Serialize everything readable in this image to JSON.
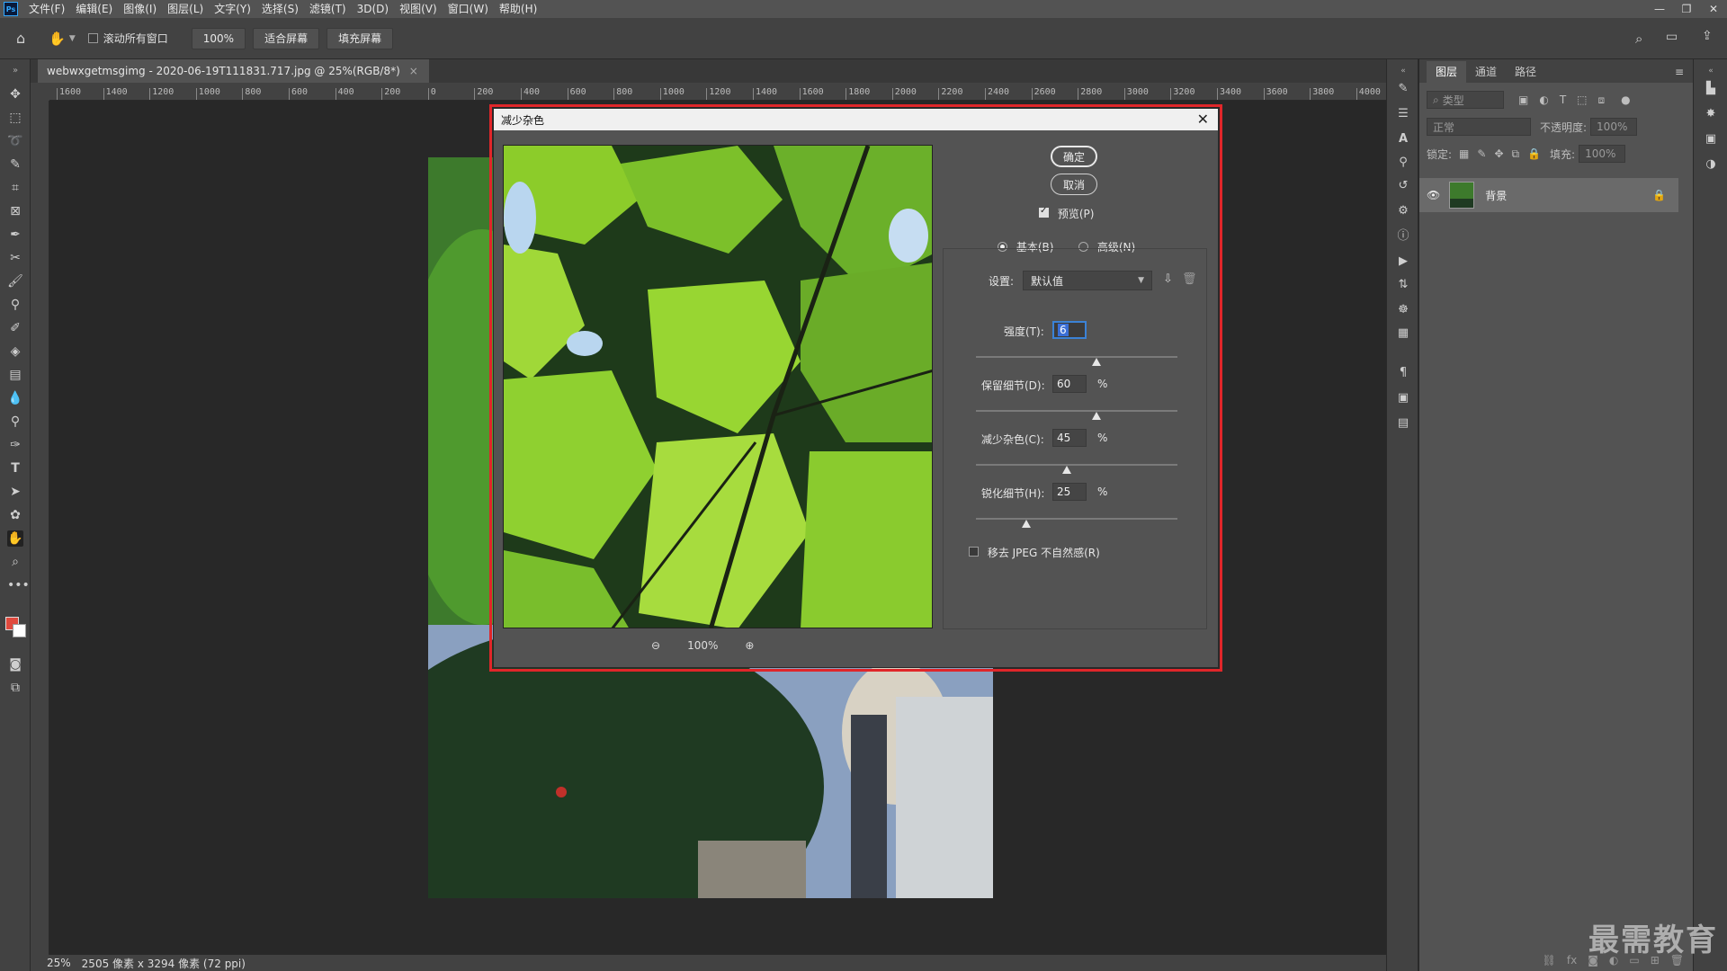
{
  "menu": {
    "logo": "Ps",
    "items": [
      "文件(F)",
      "编辑(E)",
      "图像(I)",
      "图层(L)",
      "文字(Y)",
      "选择(S)",
      "滤镜(T)",
      "3D(D)",
      "视图(V)",
      "窗口(W)",
      "帮助(H)"
    ]
  },
  "options": {
    "scroll_all_label": "滚动所有窗口",
    "zoom_value": "100%",
    "fit_screen": "适合屏幕",
    "fill_screen": "填充屏幕"
  },
  "document": {
    "tab_title": "webwxgetmsgimg - 2020-06-19T111831.717.jpg @ 25%(RGB/8*)",
    "tab_close": "×",
    "ruler_ticks": [
      "1600",
      "1400",
      "1200",
      "1000",
      "800",
      "600",
      "400",
      "200",
      "0",
      "200",
      "400",
      "600",
      "800",
      "1000",
      "1200",
      "1400",
      "1600",
      "1800",
      "2000",
      "2200",
      "2400",
      "2600",
      "2800",
      "3000",
      "3200",
      "3400",
      "3600",
      "3800",
      "4000"
    ]
  },
  "status": {
    "zoom": "25%",
    "info": "2505 像素 x 3294 像素 (72 ppi)"
  },
  "layers_panel": {
    "tabs": [
      "图层",
      "通道",
      "路径"
    ],
    "filter_placeholder": "类型",
    "blend_mode": "正常",
    "opacity_label": "不透明度:",
    "opacity_value": "100%",
    "lock_label": "锁定:",
    "fill_label": "填充:",
    "fill_value": "100%",
    "layer_name": "背景"
  },
  "watermark": "最需教育",
  "dialog": {
    "title": "减少杂色",
    "ok": "确定",
    "cancel": "取消",
    "preview_label": "预览(P)",
    "preview_checked": true,
    "mode_basic": "基本(B)",
    "mode_advanced": "高级(N)",
    "mode_selected": "basic",
    "settings_label": "设置:",
    "settings_value": "默认值",
    "zoom_value": "100%",
    "strength_label": "强度(T):",
    "strength_value": "6",
    "strength_level": 6,
    "strength_max": 10,
    "preserve_label": "保留细节(D):",
    "preserve_value": "60",
    "preserve_level": 60,
    "reduce_color_label": "减少杂色(C):",
    "reduce_color_value": "45",
    "reduce_color_level": 45,
    "sharpen_label": "锐化细节(H):",
    "sharpen_value": "25",
    "sharpen_level": 25,
    "percent": "%",
    "jpeg_label": "移去 JPEG 不自然感(R)",
    "jpeg_checked": false
  }
}
